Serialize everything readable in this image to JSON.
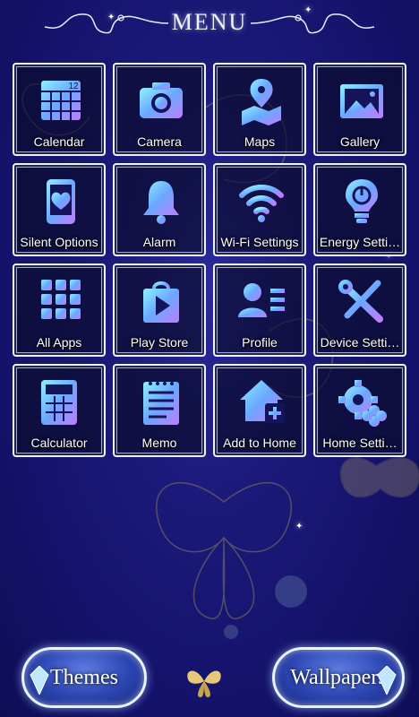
{
  "header": {
    "title": "MENU"
  },
  "apps": [
    {
      "label": "Calendar",
      "icon": "calendar-icon",
      "badge": "12"
    },
    {
      "label": "Camera",
      "icon": "camera-icon"
    },
    {
      "label": "Maps",
      "icon": "map-pin-icon"
    },
    {
      "label": "Gallery",
      "icon": "gallery-icon"
    },
    {
      "label": "Silent Options",
      "icon": "phone-heart-icon"
    },
    {
      "label": "Alarm",
      "icon": "bell-icon"
    },
    {
      "label": "Wi-Fi Settings",
      "icon": "wifi-icon"
    },
    {
      "label": "Energy Setti…",
      "icon": "bulb-power-icon"
    },
    {
      "label": "All Apps",
      "icon": "apps-grid-icon"
    },
    {
      "label": "Play Store",
      "icon": "play-store-icon"
    },
    {
      "label": "Profile",
      "icon": "profile-card-icon"
    },
    {
      "label": "Device Setti…",
      "icon": "tools-icon"
    },
    {
      "label": "Calculator",
      "icon": "calculator-icon"
    },
    {
      "label": "Memo",
      "icon": "notepad-icon"
    },
    {
      "label": "Add to Home",
      "icon": "house-plus-icon"
    },
    {
      "label": "Home Setti…",
      "icon": "gear-icon"
    }
  ],
  "footer": {
    "themes_label": "Themes",
    "wallpapers_label": "Wallpapers"
  },
  "colors": {
    "background": "#1b1a7a",
    "icon_gradient_start": "#7fe7ff",
    "icon_gradient_end": "#b46cff",
    "frame": "#eef2ff"
  }
}
